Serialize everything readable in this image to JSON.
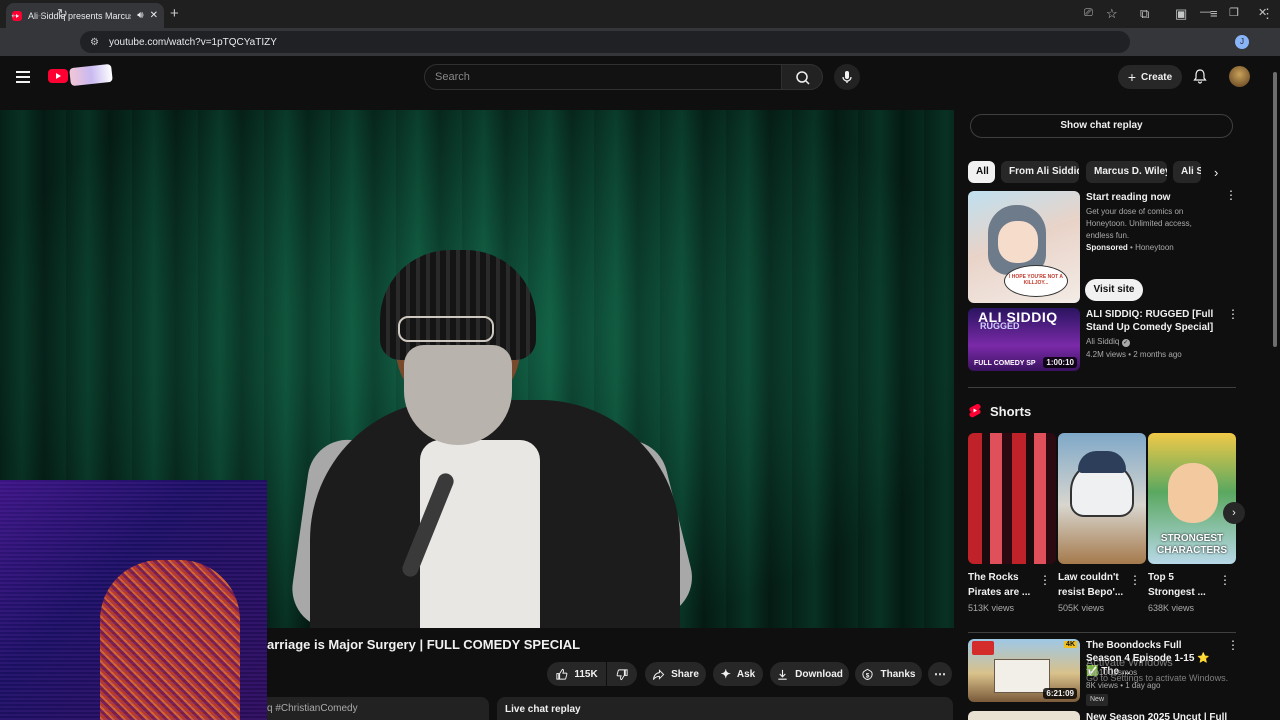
{
  "browser": {
    "tab_title": "Ali Siddiq presents Marcus",
    "url": "youtube.com/watch?v=1pTQCYaTIZY",
    "profile_initial": "J"
  },
  "header": {
    "search_placeholder": "Search",
    "create_label": "Create"
  },
  "video": {
    "title": "arriage is Major Surgery | FULL COMEDY SPECIAL",
    "likes": "115K",
    "share_label": "Share",
    "ask_label": "Ask",
    "download_label": "Download",
    "thanks_label": "Thanks",
    "description_snippet": "q #ChristianComedy",
    "live_chat_label": "Live chat replay"
  },
  "sidebar": {
    "show_chat_replay": "Show chat replay",
    "chips": [
      "All",
      "From Ali Siddiq",
      "Marcus D. Wiley",
      "Ali S"
    ],
    "ad": {
      "title": "Start reading now",
      "description": "Get your dose of comics on Honeytoon. Unlimited access, endless fun.",
      "sponsored": "Sponsored",
      "advertiser": "Honeytoon",
      "cta": "Visit site",
      "thumb_text": "I HOPE YOU'RE NOT A KILLJOY..."
    },
    "video1": {
      "title": "ALI SIDDIQ: RUGGED [Full Stand Up Comedy Special]",
      "channel": "Ali Siddiq",
      "meta": "4.2M views • 2 months ago",
      "duration": "1:00:10",
      "thumb_line1": "ALI SIDDIQ",
      "thumb_line2": "RUGGED",
      "thumb_line3": "FULL COMEDY SP"
    },
    "shorts_label": "Shorts",
    "shorts": [
      {
        "title": "The Rocks Pirates are ...",
        "views": "513K views"
      },
      {
        "title": "Law couldn't resist Bepo'...",
        "views": "505K views"
      },
      {
        "title": "Top 5 Strongest ...",
        "views": "638K views",
        "thumb_text": "STRONGEST CHARACTERS"
      }
    ],
    "video2": {
      "title": "The Boondocks Full Season 4 Episode 1-15 ⭐ ✅ The ...",
      "channel": "Top10Cosmos",
      "meta": "8K views • 1 day ago",
      "badge": "New",
      "duration": "6:21:09",
      "quality": "4K"
    },
    "video3_title": "New Season 2025 Uncut | Full"
  },
  "overlay": {
    "activate_title": "Activate Windows",
    "activate_sub": "Go to Settings to activate Windows."
  },
  "colors": {
    "youtube_red": "#ff0033",
    "background": "#0f0f0f"
  }
}
